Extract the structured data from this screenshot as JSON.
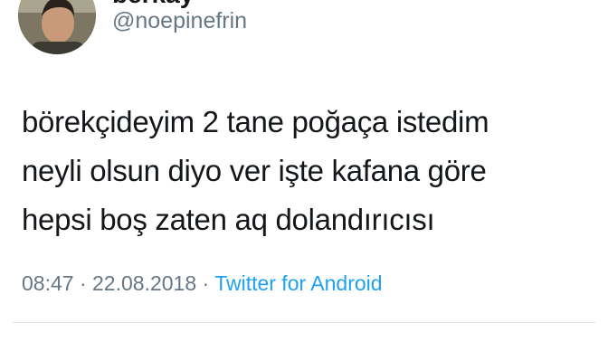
{
  "user": {
    "display_name": "berkay",
    "handle": "@noepinefrin",
    "avatar": "profile-photo"
  },
  "tweet": {
    "lines": [
      "börekçideyim 2 tane poğaça istedim",
      "neyli olsun diyo ver işte kafana göre",
      "hepsi boş zaten aq dolandırıcısı"
    ]
  },
  "meta": {
    "time": "08:47",
    "separator": "·",
    "date": "22.08.2018",
    "source": "Twitter for Android"
  },
  "colors": {
    "text": "#14171a",
    "muted": "#657786",
    "link": "#1da1f2",
    "divider": "#dfe3e6"
  }
}
